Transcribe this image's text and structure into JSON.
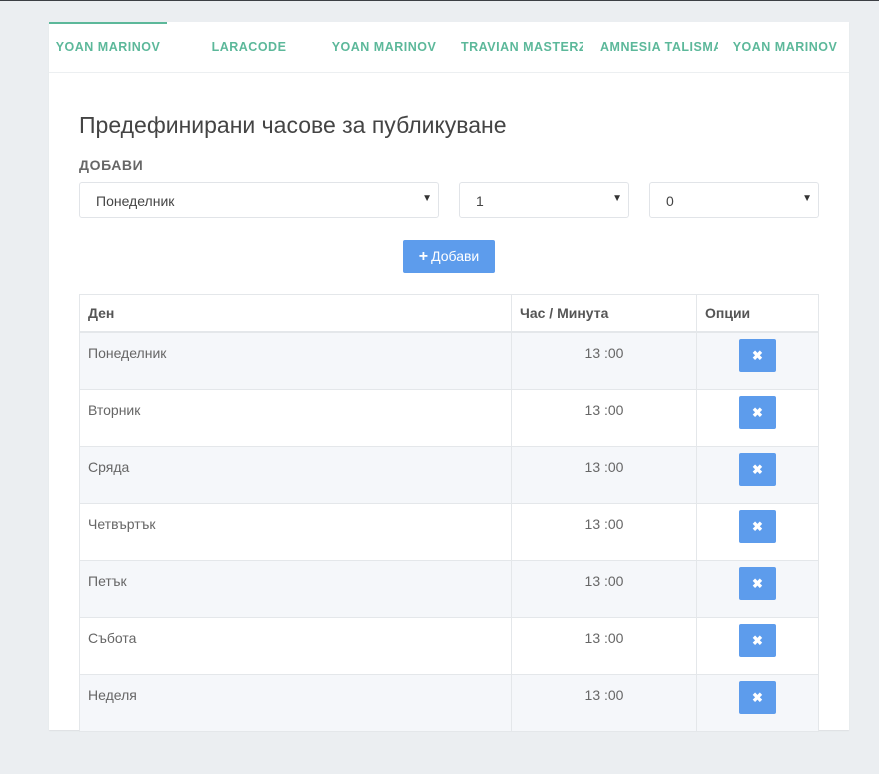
{
  "tabs": [
    {
      "label": "YOAN MARINOV",
      "active": true
    },
    {
      "label": "LARACODE",
      "active": false
    },
    {
      "label": "YOAN MARINOV",
      "active": false
    },
    {
      "label": "TRAVIAN MASTERZ",
      "active": false
    },
    {
      "label": "AMNESIA TALISMAN",
      "active": false
    },
    {
      "label": "YOAN MARINOV",
      "active": false
    }
  ],
  "page": {
    "heading": "Предефинирани часове за публикуване",
    "add_label": "ДОБАВИ"
  },
  "form": {
    "day_value": "Понеделник",
    "hour_value": "1",
    "minute_value": "0",
    "add_button": "Добави"
  },
  "table": {
    "headers": {
      "day": "Ден",
      "time": "Час / Минута",
      "options": "Опции"
    },
    "rows": [
      {
        "day": "Понеделник",
        "time": "13 :00"
      },
      {
        "day": "Вторник",
        "time": "13 :00"
      },
      {
        "day": "Сряда",
        "time": "13 :00"
      },
      {
        "day": "Четвъртък",
        "time": "13 :00"
      },
      {
        "day": "Петък",
        "time": "13 :00"
      },
      {
        "day": "Събота",
        "time": "13 :00"
      },
      {
        "day": "Неделя",
        "time": "13 :00"
      }
    ]
  },
  "icons": {
    "caret": "caret-down-icon",
    "plus": "plus-icon",
    "delete": "close-icon"
  },
  "colors": {
    "accent_tab": "#5cb89a",
    "button": "#5d9cec",
    "background": "#ebeef1"
  }
}
